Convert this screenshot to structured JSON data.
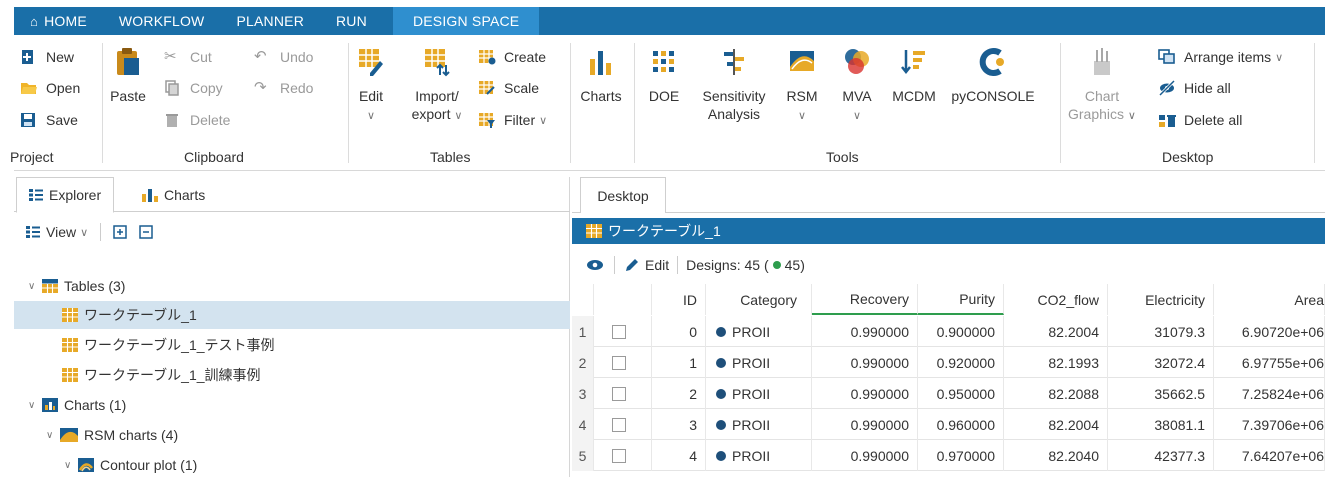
{
  "menu": {
    "tabs": [
      "HOME",
      "WORKFLOW",
      "PLANNER",
      "RUN",
      "DESIGN SPACE"
    ],
    "active": "DESIGN SPACE"
  },
  "ribbon": {
    "project": {
      "new": "New",
      "open": "Open",
      "save": "Save",
      "label": "Project"
    },
    "clipboard": {
      "paste": "Paste",
      "cut": "Cut",
      "copy": "Copy",
      "delete": "Delete",
      "undo": "Undo",
      "redo": "Redo",
      "label": "Clipboard"
    },
    "tables": {
      "edit": "Edit",
      "import_l1": "Import/",
      "import_l2": "export",
      "create": "Create",
      "scale": "Scale",
      "filter": "Filter",
      "label": "Tables"
    },
    "charts": {
      "charts": "Charts"
    },
    "tools": {
      "doe": "DOE",
      "sens_l1": "Sensitivity",
      "sens_l2": "Analysis",
      "rsm": "RSM",
      "mva": "MVA",
      "mcdm": "MCDM",
      "pyconsole": "pyCONSOLE",
      "label": "Tools"
    },
    "desktop": {
      "chart_l1": "Chart",
      "chart_l2": "Graphics",
      "arrange": "Arrange items",
      "hide_all": "Hide all",
      "delete_all": "Delete all",
      "label": "Desktop"
    }
  },
  "left_panel": {
    "tabs": [
      "Explorer",
      "Charts"
    ],
    "view_label": "View",
    "tree": {
      "tables": "Tables (3)",
      "table1": "ワークテーブル_1",
      "table2": "ワークテーブル_1_テスト事例",
      "table3": "ワークテーブル_1_訓練事例",
      "charts": "Charts (1)",
      "rsm": "RSM charts (4)",
      "contour": "Contour plot (1)"
    }
  },
  "right_panel": {
    "desktop_tab": "Desktop",
    "window_title": "ワークテーブル_1",
    "edit_label": "Edit",
    "designs_prefix": "Designs: 45 (",
    "designs_count": "45",
    "designs_suffix": ")",
    "columns": [
      "ID",
      "Category",
      "Recovery",
      "Purity",
      "CO2_flow",
      "Electricity",
      "Area"
    ],
    "rows": [
      {
        "num": "1",
        "id": "0",
        "category": "PROII",
        "recovery": "0.990000",
        "purity": "0.900000",
        "co2": "82.2004",
        "elec": "31079.3",
        "area": "6.90720e+06"
      },
      {
        "num": "2",
        "id": "1",
        "category": "PROII",
        "recovery": "0.990000",
        "purity": "0.920000",
        "co2": "82.1993",
        "elec": "32072.4",
        "area": "6.97755e+06"
      },
      {
        "num": "3",
        "id": "2",
        "category": "PROII",
        "recovery": "0.990000",
        "purity": "0.950000",
        "co2": "82.2088",
        "elec": "35662.5",
        "area": "7.25824e+06"
      },
      {
        "num": "4",
        "id": "3",
        "category": "PROII",
        "recovery": "0.990000",
        "purity": "0.960000",
        "co2": "82.2004",
        "elec": "38081.1",
        "area": "7.39706e+06"
      },
      {
        "num": "5",
        "id": "4",
        "category": "PROII",
        "recovery": "0.990000",
        "purity": "0.970000",
        "co2": "82.2040",
        "elec": "42377.3",
        "area": "7.64207e+06"
      }
    ]
  },
  "colors": {
    "menubar": "#1a6fa8",
    "active_tab": "#2f8fcf",
    "selection": "#d3e3ef",
    "category_dot": "#1e4f7a",
    "status_dot": "#2e9d4d"
  }
}
